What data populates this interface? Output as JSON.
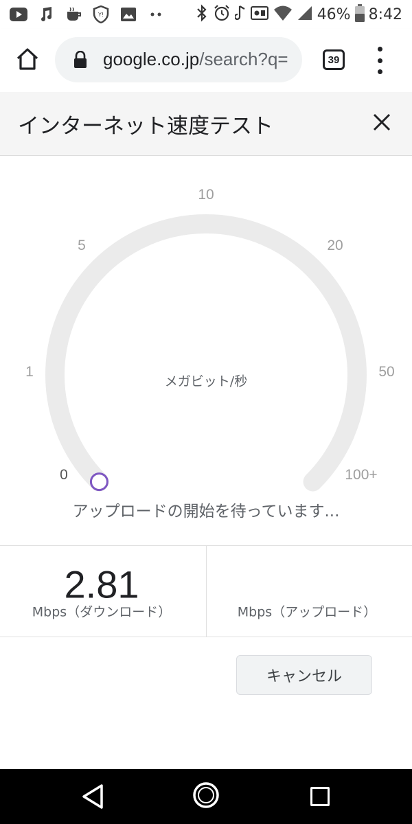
{
  "status_bar": {
    "battery_percent": "46%",
    "time": "8:42",
    "left_icons": [
      "youtube-icon",
      "music-icon",
      "cup-icon",
      "shield-icon",
      "image-icon",
      "more-dots-icon"
    ],
    "right_icons": [
      "bluetooth-icon",
      "alarm-icon",
      "music-note-icon",
      "radio-icon",
      "wifi-icon",
      "signal-icon",
      "battery-icon"
    ]
  },
  "browser": {
    "url_host": "google.co.jp",
    "url_rest": "/search?q=",
    "tab_count": "39",
    "icons": [
      "home-icon",
      "lock-icon",
      "tabs-icon",
      "menu-icon"
    ]
  },
  "panel": {
    "title": "インターネット速度テスト",
    "close_icon": "close-icon"
  },
  "gauge": {
    "tick_labels": [
      "0",
      "1",
      "5",
      "10",
      "20",
      "50",
      "100+"
    ],
    "unit": "メガビット/秒",
    "current_value": 0,
    "track_color": "#ebebeb",
    "indicator_color": "#7e57c2"
  },
  "status_message": "アップロードの開始を待っています...",
  "results": {
    "download_value": "2.81",
    "download_label": "Mbps（ダウンロード）",
    "upload_value": "",
    "upload_label": "Mbps（アップロード）"
  },
  "actions": {
    "cancel_label": "キャンセル"
  },
  "nav_bar": {
    "icons": [
      "back-icon",
      "home-circle-icon",
      "recents-icon"
    ]
  }
}
